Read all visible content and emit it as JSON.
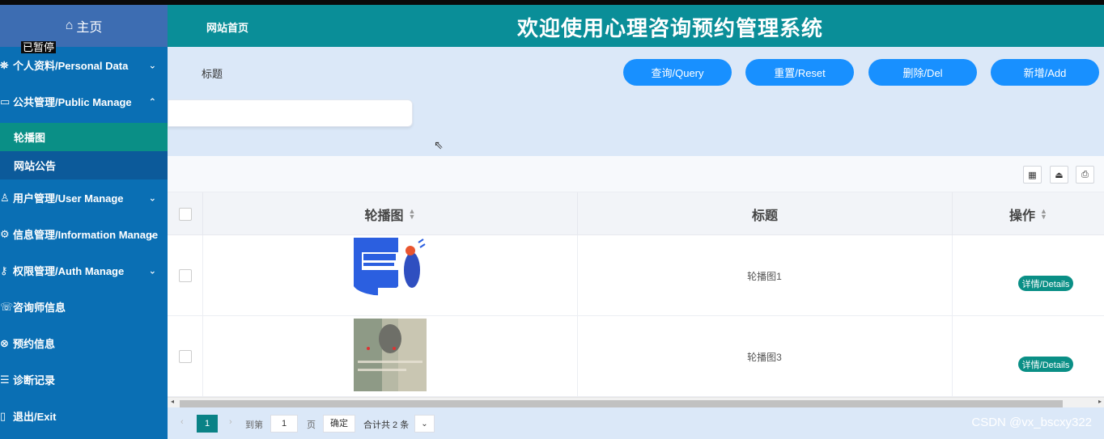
{
  "sidebar": {
    "home_label": "主页",
    "paused_label": "已暂停",
    "items": [
      {
        "label": "个人资料/Personal Data",
        "icon": "user-card-icon",
        "chevron": "˅"
      },
      {
        "label": "公共管理/Public Manage",
        "icon": "monitor-icon",
        "chevron": "˄"
      },
      {
        "label": "用户管理/User Manage",
        "icon": "user-icon",
        "chevron": "˅"
      },
      {
        "label": "信息管理/Information Manage",
        "icon": "settings-icon",
        "chevron": "˅"
      },
      {
        "label": "权限管理/Auth Manage",
        "icon": "key-icon",
        "chevron": "˅"
      },
      {
        "label": "咨询师信息",
        "icon": "chat-icon"
      },
      {
        "label": "预约信息",
        "icon": "calendar-icon"
      },
      {
        "label": "诊断记录",
        "icon": "list-icon"
      },
      {
        "label": "退出/Exit",
        "icon": "exit-icon"
      }
    ],
    "subitems": [
      {
        "label": "轮播图",
        "active": true
      },
      {
        "label": "网站公告",
        "active": false
      }
    ]
  },
  "header": {
    "site_home": "网站首页",
    "title": "欢迎使用心理咨询预约管理系统"
  },
  "search": {
    "label": "标题",
    "placeholder": "",
    "buttons": {
      "query": "查询/Query",
      "reset": "重置/Reset",
      "delete": "删除/Del",
      "add": "新增/Add"
    }
  },
  "table": {
    "columns": [
      "轮播图",
      "标题",
      "操作"
    ],
    "rows": [
      {
        "title": "轮播图1",
        "action": "详情/Details"
      },
      {
        "title": "轮播图3",
        "action": "详情/Details"
      }
    ]
  },
  "pager": {
    "current": "1",
    "goto_label": "到第",
    "goto_value": "1",
    "page_label": "页",
    "confirm": "确定",
    "total": "合计共 2 条"
  },
  "watermark": "CSDN @vx_bscxy322",
  "colors": {
    "sidebar": "#0a6fb4",
    "header": "#0a8e98",
    "button": "#1890ff",
    "badge": "#0a8f86"
  }
}
